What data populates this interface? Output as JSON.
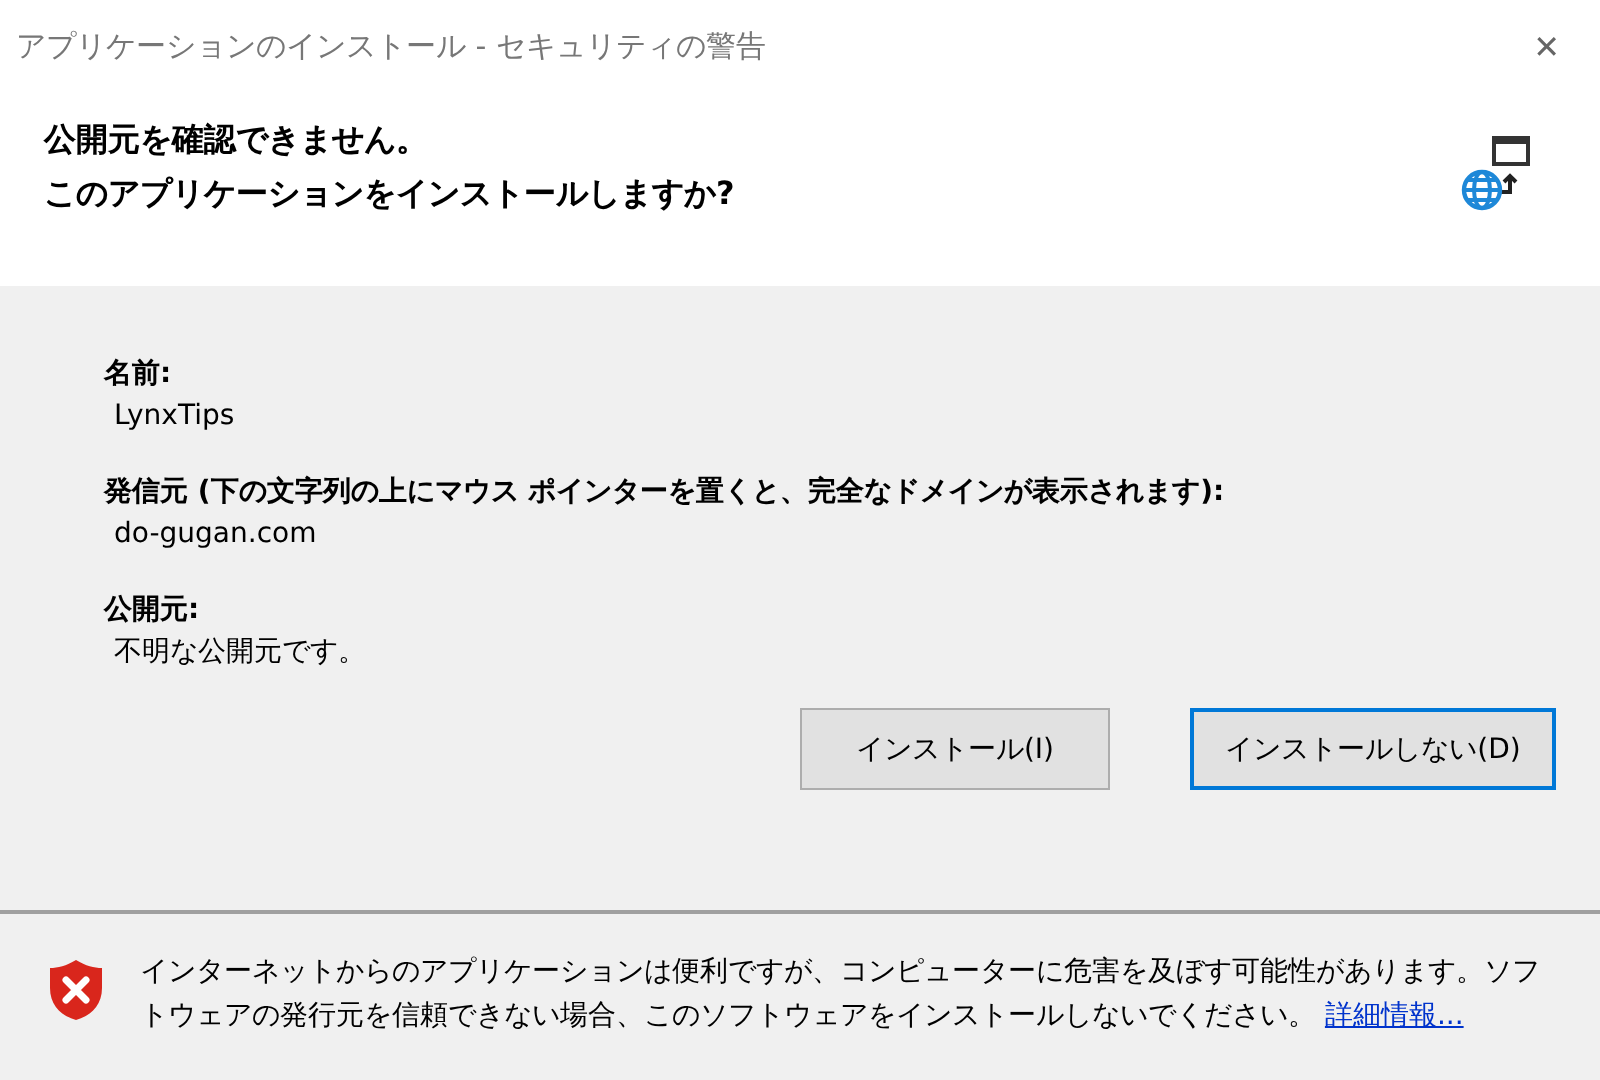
{
  "window": {
    "title": "アプリケーションのインストール - セキュリティの警告",
    "close": "✕"
  },
  "header": {
    "lines": [
      "公開元を確認できません。",
      "このアプリケーションをインストールしますか?"
    ]
  },
  "fields": [
    {
      "label": "名前:",
      "value": "LynxTips"
    },
    {
      "label": "発信元 (下の文字列の上にマウス ポインターを置くと、完全なドメインが表示されます):",
      "value": "do-gugan.com"
    },
    {
      "label": "公開元:",
      "value": "不明な公開元です。"
    }
  ],
  "buttons": [
    {
      "label": "インストール(I)",
      "default": false
    },
    {
      "label": "インストールしない(D)",
      "default": true
    }
  ],
  "footer": {
    "message": "インターネットからのアプリケーションは便利ですが、コンピューターに危害を及ぼす可能性があります。ソフトウェアの発行元を信頼できない場合、このソフトウェアをインストールしないでください。",
    "link": "詳細情報..."
  }
}
